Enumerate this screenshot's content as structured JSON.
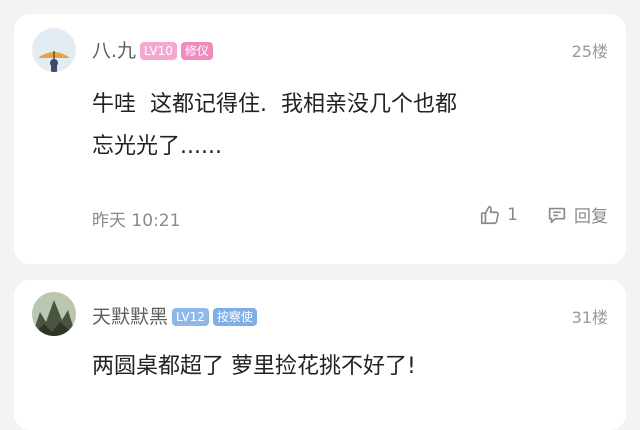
{
  "comments": [
    {
      "username": "八.九",
      "level_badge": "LV10",
      "title_badge": "修仪",
      "floor": "25楼",
      "content": "牛哇  这都记得住.  我相亲没几个也都\n忘光光了......",
      "time": "昨天 10:21",
      "like_count": "1",
      "reply_label": "回复",
      "colors": {
        "level_badge": "#f3a9cf",
        "title_badge": "#ef8bbf"
      }
    },
    {
      "username": "天默默黑",
      "level_badge": "LV12",
      "title_badge": "按察使",
      "floor": "31楼",
      "content": "两圆桌都超了 萝里捡花挑不好了!",
      "colors": {
        "level_badge": "#8fb8ea",
        "title_badge": "#7eaee8"
      }
    }
  ]
}
